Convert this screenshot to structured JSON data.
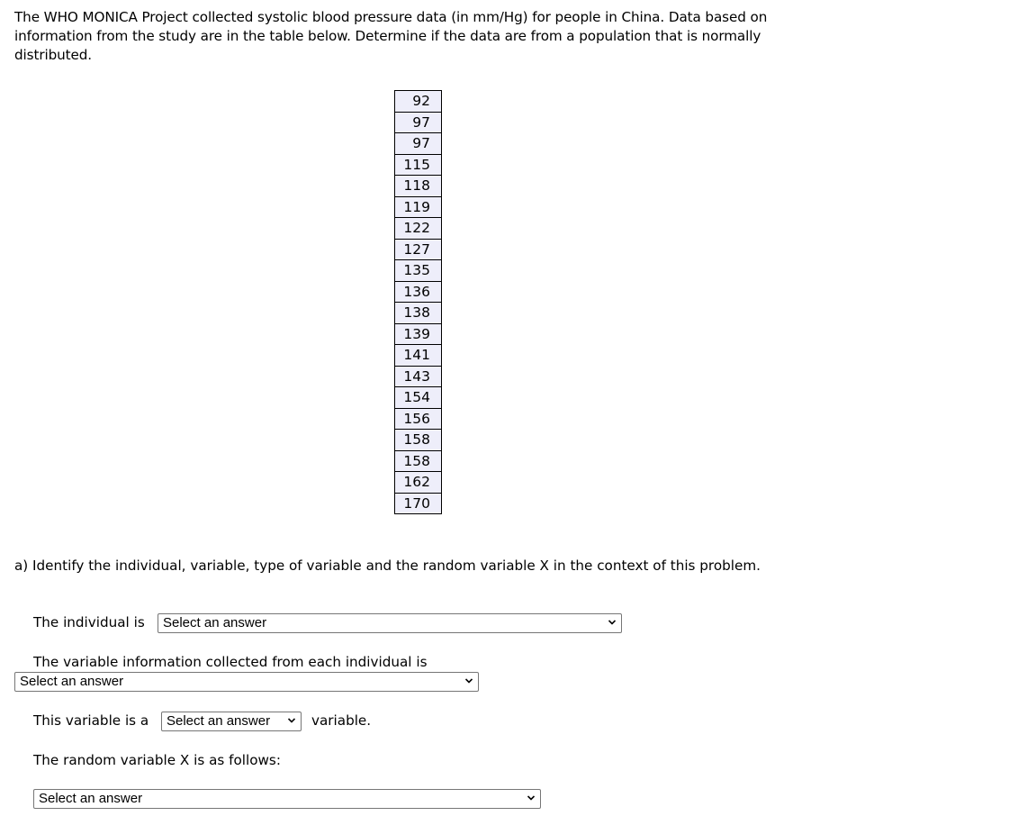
{
  "intro": "The WHO MONICA Project collected systolic blood pressure data (in mm/Hg) for people in China. Data based on information from the study are in the table below. Determine if the data are from a population that is normally distributed.",
  "table": {
    "values": [
      "92",
      "97",
      "97",
      "115",
      "118",
      "119",
      "122",
      "127",
      "135",
      "136",
      "138",
      "139",
      "141",
      "143",
      "154",
      "156",
      "158",
      "158",
      "162",
      "170"
    ]
  },
  "part_a": {
    "prompt": "a) Identify the individual, variable, type of variable and the random variable X in the context of this problem.",
    "individual_label": "The individual is",
    "individual_select": "Select an answer",
    "variable_label": "The variable information collected from each individual is",
    "variable_select": "Select an answer",
    "type_label_before": "This variable is a",
    "type_select": "Select an answer",
    "type_label_after": "variable.",
    "random_label": "The random variable X is as follows:",
    "random_select": "Select an answer"
  },
  "icons": {
    "dropdown": "chevron-down-icon"
  }
}
